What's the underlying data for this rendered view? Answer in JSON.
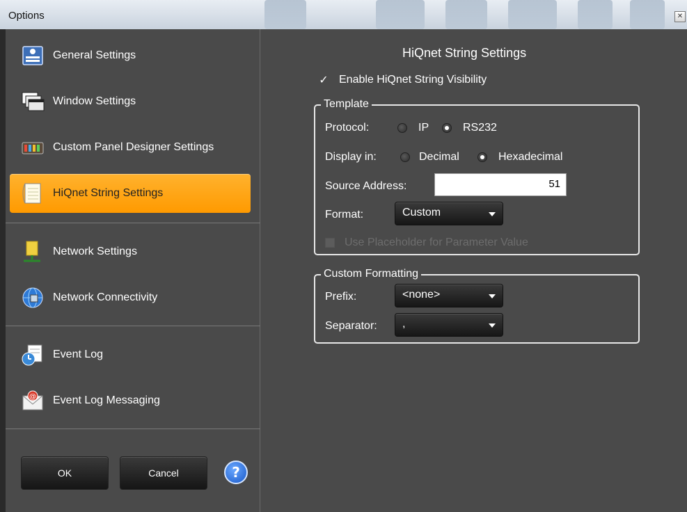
{
  "window": {
    "title": "Options",
    "close_icon": "close-icon"
  },
  "sidebar": {
    "items": [
      {
        "label": "General Settings",
        "icon": "general-settings-icon",
        "active": false
      },
      {
        "label": "Window Settings",
        "icon": "window-settings-icon",
        "active": false
      },
      {
        "label": "Custom Panel Designer Settings",
        "icon": "panel-designer-icon",
        "active": false
      },
      {
        "label": "HiQnet String Settings",
        "icon": "notepad-icon",
        "active": true
      },
      {
        "label": "Network Settings",
        "icon": "network-settings-icon",
        "active": false
      },
      {
        "label": "Network Connectivity",
        "icon": "network-connectivity-icon",
        "active": false
      },
      {
        "label": "Event Log",
        "icon": "event-log-icon",
        "active": false
      },
      {
        "label": "Event Log Messaging",
        "icon": "email-icon",
        "active": false
      }
    ],
    "ok_label": "OK",
    "cancel_label": "Cancel",
    "help_label": "?"
  },
  "main": {
    "title": "HiQnet String Settings",
    "enable_visibility": {
      "label": "Enable HiQnet String Visibility",
      "checked": true,
      "mark": "✓"
    },
    "template": {
      "legend": "Template",
      "protocol": {
        "label": "Protocol:",
        "options": [
          "IP",
          "RS232"
        ],
        "selected": "RS232"
      },
      "display_in": {
        "label": "Display in:",
        "options": [
          "Decimal",
          "Hexadecimal"
        ],
        "selected": "Hexadecimal"
      },
      "source_address": {
        "label": "Source Address:",
        "value": "51"
      },
      "format": {
        "label": "Format:",
        "value": "Custom"
      },
      "placeholder": {
        "label": "Use Placeholder for Parameter Value",
        "checked": false,
        "enabled": false
      }
    },
    "custom_formatting": {
      "legend": "Custom Formatting",
      "prefix": {
        "label": "Prefix:",
        "value": "<none>"
      },
      "separator": {
        "label": "Separator:",
        "value": ","
      }
    }
  },
  "colors": {
    "background": "#4a4a4a",
    "active_item": "#ffa61a",
    "titlebar": "#dde4ec",
    "border": "#e8e8e8"
  }
}
